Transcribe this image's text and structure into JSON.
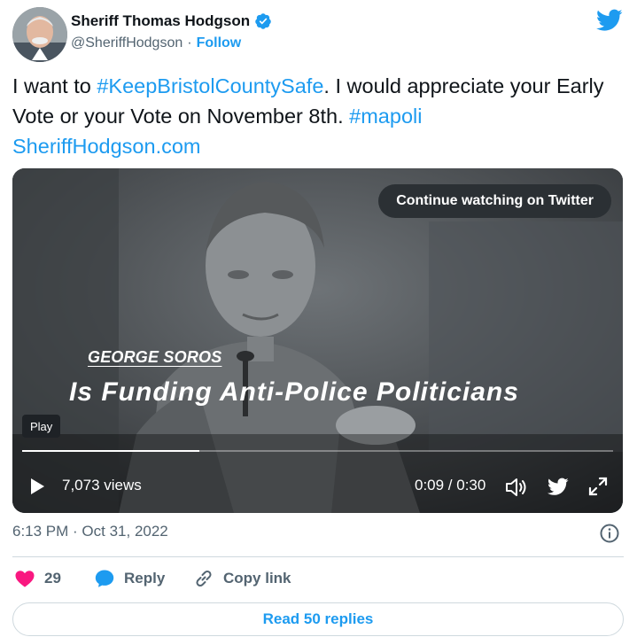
{
  "author": {
    "display_name": "Sheriff Thomas Hodgson",
    "handle": "@SheriffHodgson",
    "separator": "·",
    "follow_label": "Follow",
    "verified": true
  },
  "tweet": {
    "text_part1": "I want to ",
    "hashtag1": "#KeepBristolCountySafe",
    "text_part2": ".  I would appreciate your Early Vote or your Vote on November 8th.  ",
    "hashtag2": "#mapoli",
    "link": "SheriffHodgson.com"
  },
  "video": {
    "continue_label": "Continue watching on Twitter",
    "caption_name": "GEORGE SOROS",
    "caption_main": "Is Funding Anti-Police Politicians",
    "play_tooltip": "Play",
    "views": "7,073 views",
    "time": "0:09 / 0:30",
    "progress_fraction": 0.3
  },
  "meta": {
    "timestamp": "6:13 PM · Oct 31, 2022"
  },
  "actions": {
    "like_count": "29",
    "reply_label": "Reply",
    "copy_link_label": "Copy link"
  },
  "read_replies_label": "Read 50 replies",
  "colors": {
    "accent": "#1d9bf0",
    "text": "#0f1419",
    "secondary": "#536471",
    "like": "#f91880",
    "border": "#cfd9de"
  },
  "icons": [
    "verified-badge-icon",
    "twitter-bird-icon",
    "play-icon",
    "volume-icon",
    "expand-icon",
    "info-icon",
    "heart-icon",
    "reply-bubble-icon",
    "copy-link-icon"
  ]
}
